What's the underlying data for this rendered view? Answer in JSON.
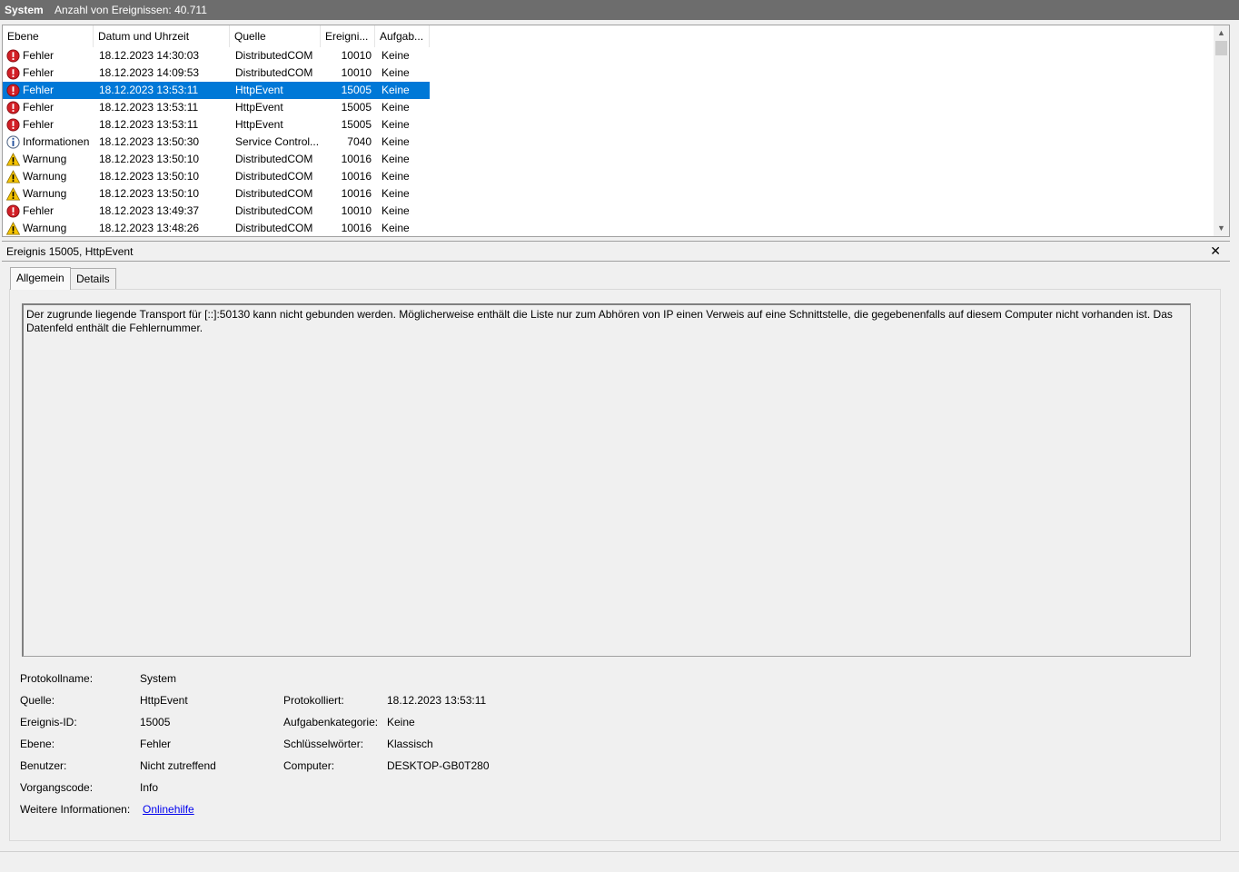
{
  "header": {
    "title": "System",
    "count": "Anzahl von Ereignissen: 40.711"
  },
  "columns": [
    "Ebene",
    "Datum und Uhrzeit",
    "Quelle",
    "Ereigni...",
    "Aufgab..."
  ],
  "events": [
    {
      "level": "Fehler",
      "icon": "error-icon",
      "datetime": "18.12.2023 14:30:03",
      "source": "DistributedCOM",
      "id": "10010",
      "task": "Keine",
      "selected": false
    },
    {
      "level": "Fehler",
      "icon": "error-icon",
      "datetime": "18.12.2023 14:09:53",
      "source": "DistributedCOM",
      "id": "10010",
      "task": "Keine",
      "selected": false
    },
    {
      "level": "Fehler",
      "icon": "error-icon",
      "datetime": "18.12.2023 13:53:11",
      "source": "HttpEvent",
      "id": "15005",
      "task": "Keine",
      "selected": true
    },
    {
      "level": "Fehler",
      "icon": "error-icon",
      "datetime": "18.12.2023 13:53:11",
      "source": "HttpEvent",
      "id": "15005",
      "task": "Keine",
      "selected": false
    },
    {
      "level": "Fehler",
      "icon": "error-icon",
      "datetime": "18.12.2023 13:53:11",
      "source": "HttpEvent",
      "id": "15005",
      "task": "Keine",
      "selected": false
    },
    {
      "level": "Informationen",
      "icon": "info-icon",
      "datetime": "18.12.2023 13:50:30",
      "source": "Service Control...",
      "id": "7040",
      "task": "Keine",
      "selected": false
    },
    {
      "level": "Warnung",
      "icon": "warning-icon",
      "datetime": "18.12.2023 13:50:10",
      "source": "DistributedCOM",
      "id": "10016",
      "task": "Keine",
      "selected": false
    },
    {
      "level": "Warnung",
      "icon": "warning-icon",
      "datetime": "18.12.2023 13:50:10",
      "source": "DistributedCOM",
      "id": "10016",
      "task": "Keine",
      "selected": false
    },
    {
      "level": "Warnung",
      "icon": "warning-icon",
      "datetime": "18.12.2023 13:50:10",
      "source": "DistributedCOM",
      "id": "10016",
      "task": "Keine",
      "selected": false
    },
    {
      "level": "Fehler",
      "icon": "error-icon",
      "datetime": "18.12.2023 13:49:37",
      "source": "DistributedCOM",
      "id": "10010",
      "task": "Keine",
      "selected": false
    },
    {
      "level": "Warnung",
      "icon": "warning-icon",
      "datetime": "18.12.2023 13:48:26",
      "source": "DistributedCOM",
      "id": "10016",
      "task": "Keine",
      "selected": false
    }
  ],
  "detail": {
    "title": "Ereignis 15005, HttpEvent",
    "close": "✕",
    "tabs": {
      "general": "Allgemein",
      "details": "Details"
    },
    "message": "Der zugrunde liegende Transport für [::]:50130 kann nicht gebunden werden. Möglicherweise enthält die Liste nur zum Abhören von IP einen Verweis auf eine Schnittstelle, die gegebenenfalls auf diesem Computer nicht vorhanden ist. Das Datenfeld enthält die Fehlernummer.",
    "labels": {
      "log_name": "Protokollname:",
      "source": "Quelle:",
      "event_id": "Ereignis-ID:",
      "level": "Ebene:",
      "user": "Benutzer:",
      "opcode": "Vorgangscode:",
      "more_info": "Weitere Informationen:",
      "logged": "Protokolliert:",
      "task_category": "Aufgabenkategorie:",
      "keywords": "Schlüsselwörter:",
      "computer": "Computer:"
    },
    "values": {
      "log_name": "System",
      "source": "HttpEvent",
      "event_id": "15005",
      "level": "Fehler",
      "user": "Nicht zutreffend",
      "opcode": "Info",
      "more_info": "Onlinehilfe",
      "logged": "18.12.2023 13:53:11",
      "task_category": "Keine",
      "keywords": "Klassisch",
      "computer": "DESKTOP-GB0T280"
    }
  },
  "colors": {
    "selection": "#0078d7",
    "header_bg": "#6d6d6d",
    "error": "#d21f26",
    "warning": "#f5c400",
    "info": "#ffffff"
  }
}
